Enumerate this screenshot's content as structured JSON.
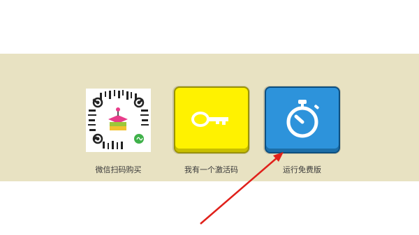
{
  "options": {
    "scan_label": "微信扫码购买",
    "activation_label": "我有一个激活码",
    "free_label": "运行免费版"
  },
  "icons": {
    "qr": "mini-program-qr-code-icon",
    "key": "key-icon",
    "stopwatch": "stopwatch-icon",
    "arrow": "red-arrow-annotation"
  },
  "colors": {
    "panel": "#e8e2c2",
    "key_tile": "#fff200",
    "free_tile": "#2d93db",
    "arrow": "#e0201a"
  }
}
